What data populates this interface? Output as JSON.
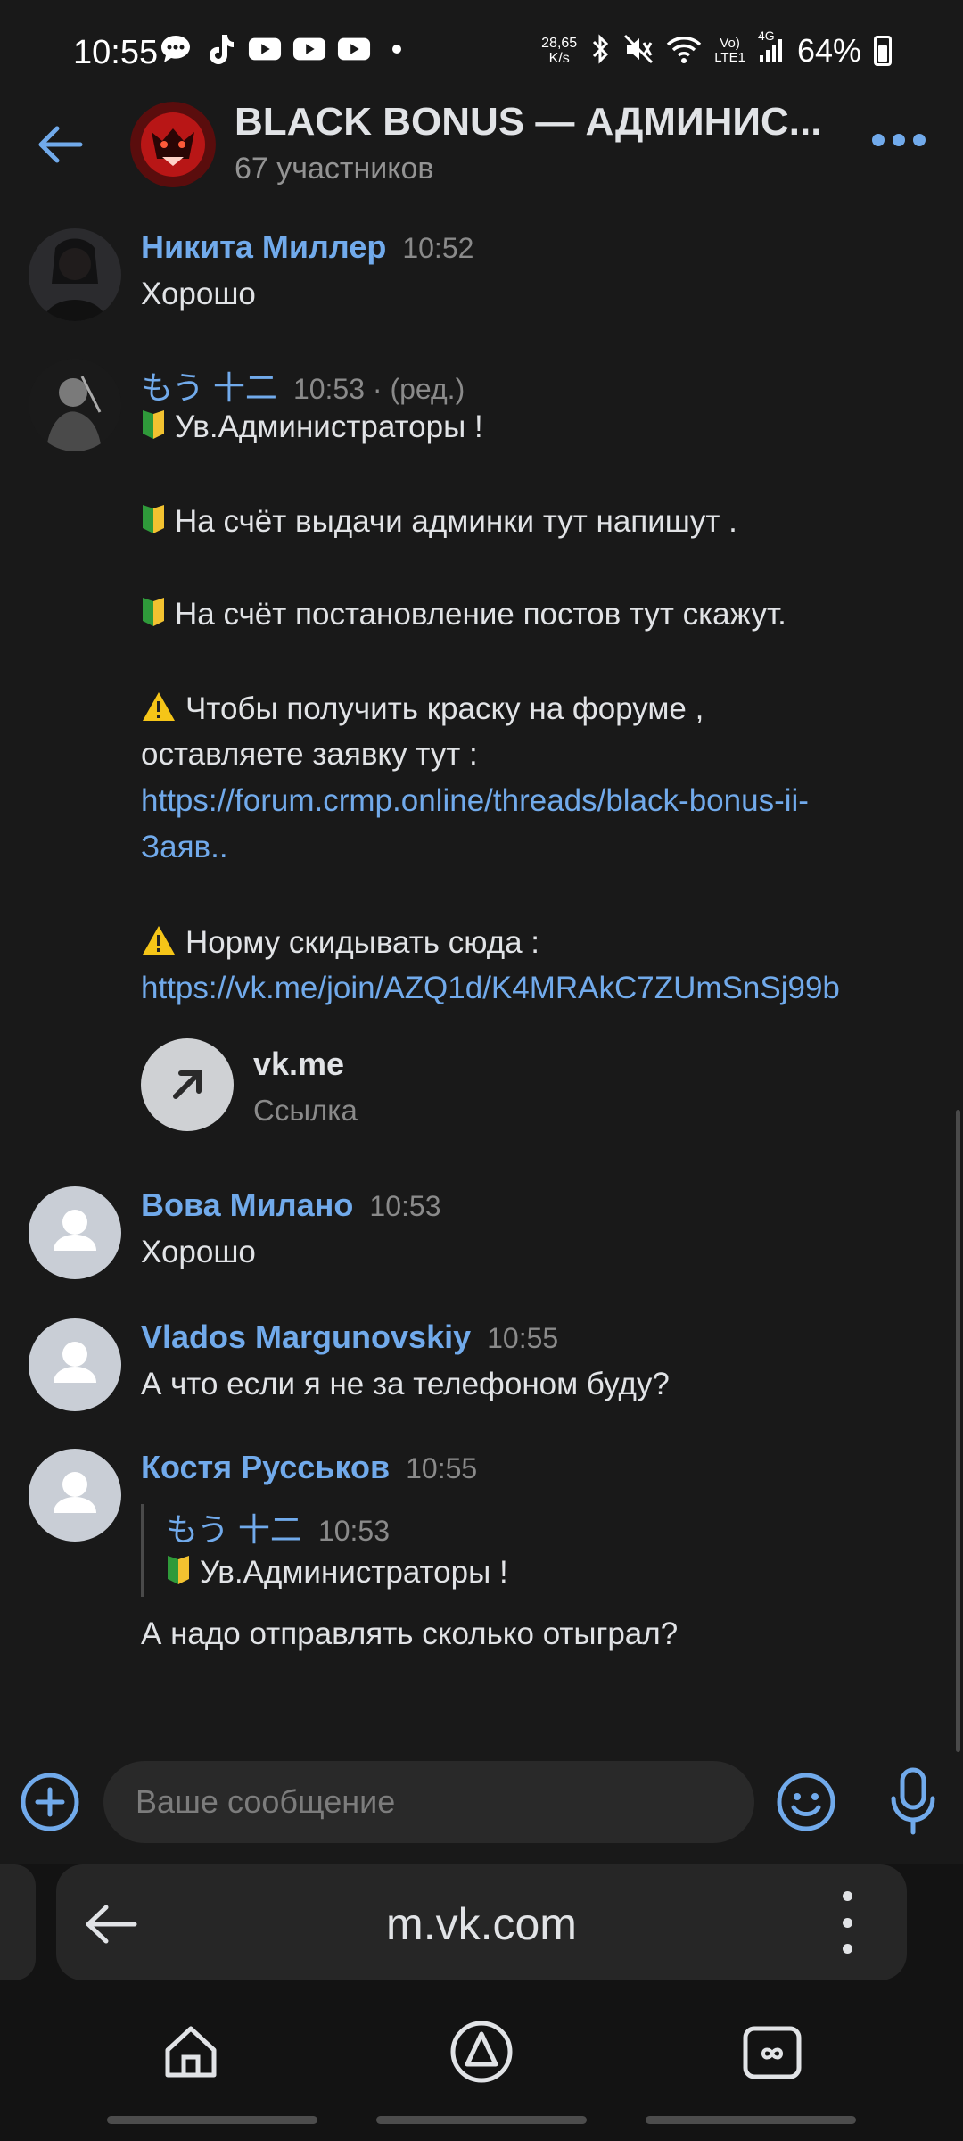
{
  "status_bar": {
    "time": "10:55",
    "net_speed_value": "28,65",
    "net_speed_unit": "K/s",
    "volte": "Vo)",
    "lte": "LTE1",
    "network": "4G",
    "battery": "64%"
  },
  "header": {
    "title": "BLACK BONUS — АДМИНИС...",
    "subtitle": "67 участников"
  },
  "messages": [
    {
      "name": "Никита Миллер",
      "time": "10:52",
      "text": "Хорошо"
    },
    {
      "name": "もう 十二",
      "time": "10:53 · (ред.)",
      "lines": [
        "Ув.Администраторы !",
        "На счёт выдачи админки тут напишут .",
        "На счёт постановление постов тут скажут.",
        "Чтобы получить краску на форуме ,",
        "оставляете заявку тут :",
        "https://forum.crmp.online/threads/black-bonus-ii-",
        "Заяв..",
        "Норму скидывать сюда :",
        "https://vk.me/join/AZQ1d/K4MRAkC7ZUmSnSj99b"
      ],
      "snippet_title": "vk.me",
      "snippet_subtitle": "Ссылка"
    },
    {
      "name": "Вова Милано",
      "time": "10:53",
      "text": "Хорошо"
    },
    {
      "name": "Vlados Margunovskiy",
      "time": "10:55",
      "text": "А что если я не за телефоном буду?"
    },
    {
      "name": "Костя Русськов",
      "time": "10:55",
      "reply_name": "もう 十二",
      "reply_time": "10:53",
      "reply_text": "Ув.Администраторы !",
      "text": "А надо отправлять сколько отыграл?"
    }
  ],
  "composer": {
    "placeholder": "Ваше сообщение"
  },
  "browser": {
    "url": "m.vk.com"
  },
  "colors": {
    "accent": "#71aaeb",
    "background": "#191919",
    "beginner_green": "#2f9a3a",
    "beginner_yellow": "#f2c230",
    "warning": "#f5c518"
  }
}
